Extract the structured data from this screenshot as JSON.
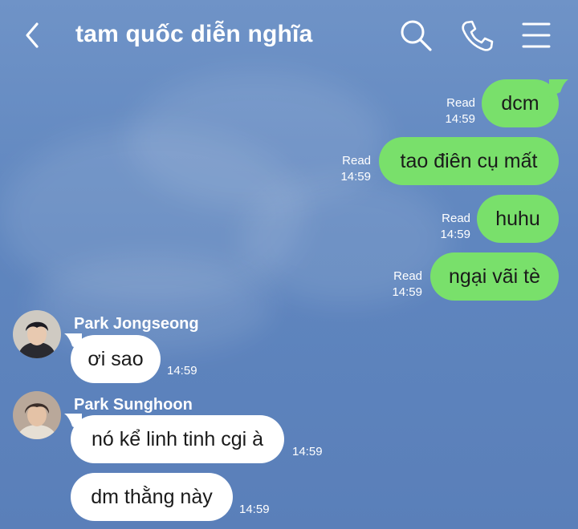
{
  "header": {
    "title": "tam quốc diễn nghĩa",
    "icons": [
      "back-chevron-icon",
      "search-icon",
      "phone-icon",
      "menu-icon"
    ]
  },
  "colors": {
    "background": "#5f86bf",
    "outgoing_bubble": "#79e06b",
    "incoming_bubble": "#ffffff",
    "text_on_bg": "#ffffff"
  },
  "messages": [
    {
      "side": "me",
      "text": "dcm",
      "read": "Read",
      "time": "14:59"
    },
    {
      "side": "me",
      "text": "tao điên cụ mất",
      "read": "Read",
      "time": "14:59"
    },
    {
      "side": "me",
      "text": "huhu",
      "read": "Read",
      "time": "14:59"
    },
    {
      "side": "me",
      "text": "ngại vãi tè",
      "read": "Read",
      "time": "14:59"
    },
    {
      "side": "them",
      "sender": "Park Jongseong",
      "text": "ơi sao",
      "time": "14:59"
    },
    {
      "side": "them",
      "sender": "Park Sunghoon",
      "text": "nó kể linh tinh cgi à",
      "time": "14:59"
    },
    {
      "side": "them",
      "text": "dm thằng này",
      "time": "14:59"
    }
  ]
}
